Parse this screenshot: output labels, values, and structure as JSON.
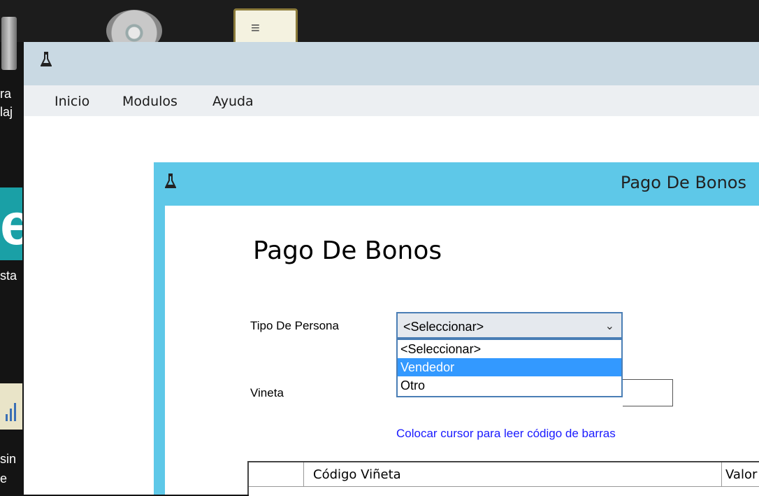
{
  "desktop": {
    "left_labels": [
      "ra",
      "laj",
      "sta",
      "sin",
      "e"
    ]
  },
  "app": {
    "menu": [
      "Inicio",
      "Modulos",
      "Ayuda"
    ]
  },
  "child_window": {
    "title": "Pago De Bonos",
    "heading": "Pago De Bonos",
    "tipo_label": "Tipo De Persona",
    "tipo_selected": "<Seleccionar>",
    "tipo_options": [
      "<Seleccionar>",
      "Vendedor",
      "Otro"
    ],
    "tipo_highlighted": "Vendedor",
    "vineta_label": "Vineta",
    "hint": "Colocar cursor para leer código de barras",
    "grid_columns": [
      "Código Viñeta",
      "Valor"
    ],
    "chevron": "⌄"
  },
  "colors": {
    "child_title_bar": "#5ec8e8",
    "app_title_bar": "#c9d9e3",
    "selection": "#3399ff",
    "hint_text": "#1a1aff"
  }
}
